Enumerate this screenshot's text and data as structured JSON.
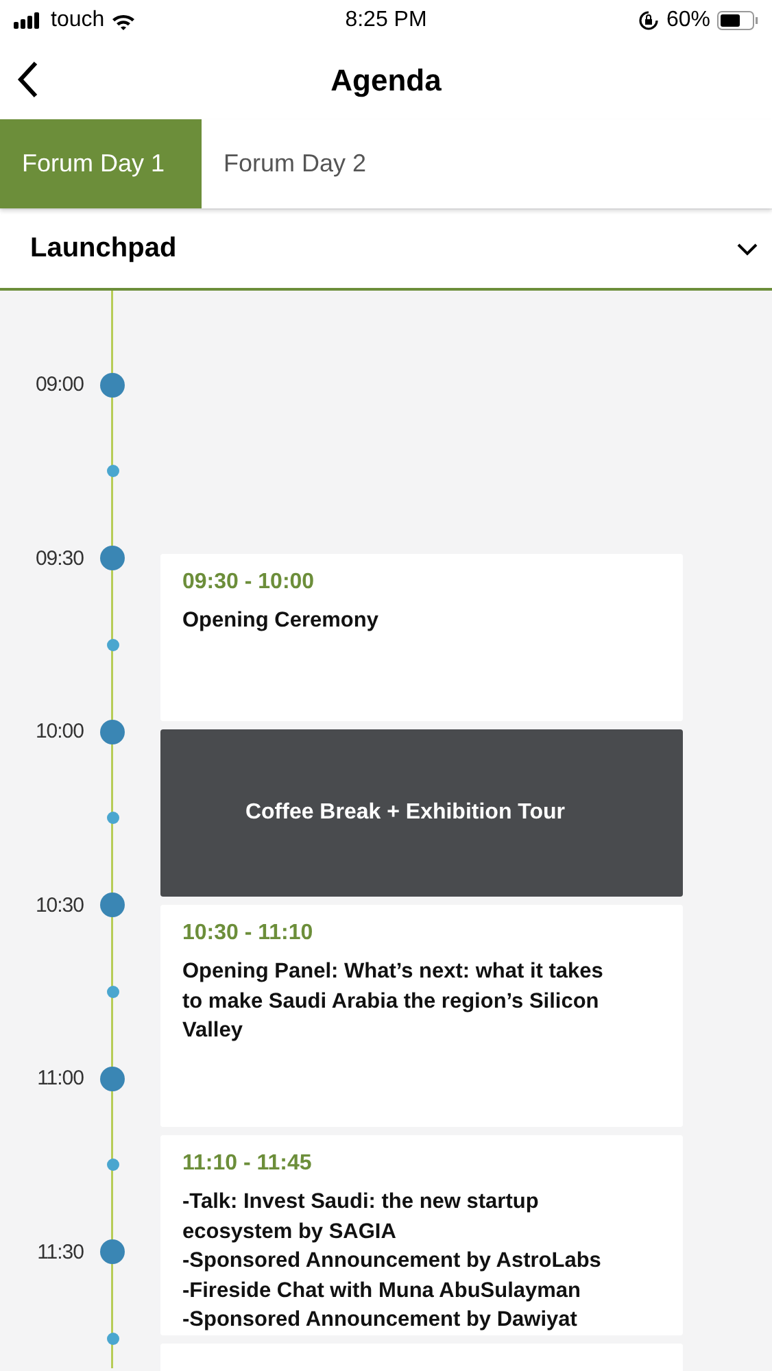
{
  "status_bar": {
    "carrier": "touch",
    "time": "8:25 PM",
    "battery": "60%"
  },
  "nav": {
    "title": "Agenda"
  },
  "tabs": [
    {
      "label": "Forum Day 1",
      "selected": true
    },
    {
      "label": "Forum Day 2",
      "selected": false
    }
  ],
  "venue_select": {
    "value": "Launchpad"
  },
  "timeline": [
    {
      "kind": "major",
      "label": "09:00"
    },
    {
      "kind": "minor"
    },
    {
      "kind": "major",
      "label": "09:30"
    },
    {
      "kind": "minor"
    },
    {
      "kind": "major",
      "label": "10:00"
    },
    {
      "kind": "minor"
    },
    {
      "kind": "major",
      "label": "10:30"
    },
    {
      "kind": "minor"
    },
    {
      "kind": "major",
      "label": "11:00"
    },
    {
      "kind": "minor"
    },
    {
      "kind": "major",
      "label": "11:30"
    },
    {
      "kind": "minor"
    }
  ],
  "sessions": [
    {
      "kind": "session",
      "time": "09:30 - 10:00",
      "title": "Opening Ceremony"
    },
    {
      "kind": "break",
      "title": "Coffee Break + Exhibition Tour"
    },
    {
      "kind": "session",
      "time": "10:30 - 11:10",
      "title": "Opening Panel: What’s next: what it takes to make Saudi Arabia the region’s Silicon Valley"
    },
    {
      "kind": "session",
      "time": "11:10 - 11:45",
      "title": "-Talk: Invest Saudi: the new startup ecosystem by SAGIA\n-Sponsored Announcement by AstroLabs\n-Fireside Chat with Muna AbuSulayman\n-Sponsored Announcement by Dawiyat"
    },
    {
      "kind": "session"
    }
  ]
}
